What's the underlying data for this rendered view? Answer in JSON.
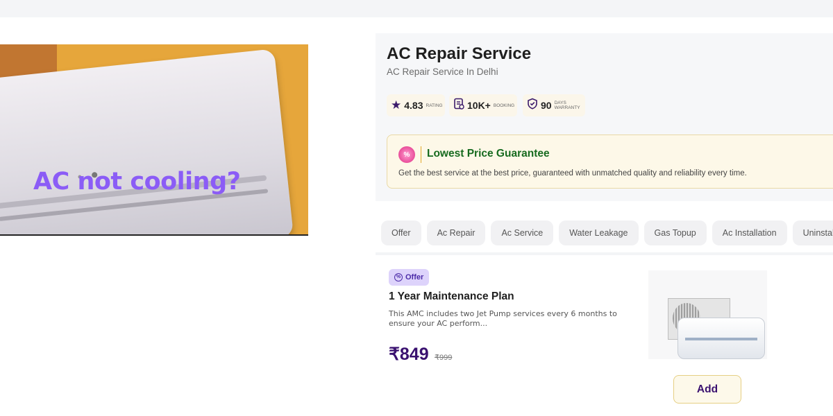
{
  "hero": {
    "heading": "AC not cooling?"
  },
  "service": {
    "title": "AC Repair Service",
    "subtitle": "AC Repair Service In Delhi",
    "stats": {
      "rating": {
        "icon": "star-icon",
        "value": "4.83",
        "label": "RATING"
      },
      "booking": {
        "icon": "booking-icon",
        "value": "10K+",
        "label": "BOOKING"
      },
      "warranty": {
        "icon": "shield-check-icon",
        "value": "90",
        "label_line1": "DAYS",
        "label_line2": "WARRANTY"
      }
    },
    "guarantee": {
      "title": "Lowest Price Guarantee",
      "description": "Get the best service at the best price, guaranteed with unmatched quality and reliability every time."
    }
  },
  "categories": [
    {
      "label": "Offer"
    },
    {
      "label": "Ac Repair"
    },
    {
      "label": "Ac Service"
    },
    {
      "label": "Water Leakage"
    },
    {
      "label": "Gas Topup"
    },
    {
      "label": "Ac Installation"
    },
    {
      "label": "Uninstallation"
    }
  ],
  "product": {
    "badge": "Offer",
    "title": "1 Year Maintenance Plan",
    "description": "This AMC includes two Jet Pump services every 6 months to ensure your AC perform...",
    "price": "₹849",
    "original_price": "₹999",
    "add_label": "Add"
  },
  "colors": {
    "accent_purple": "#3a1170",
    "hero_text": "#8b5cf6",
    "guarantee_green": "#176b1f",
    "offer_badge_bg": "#ddd3fb"
  }
}
